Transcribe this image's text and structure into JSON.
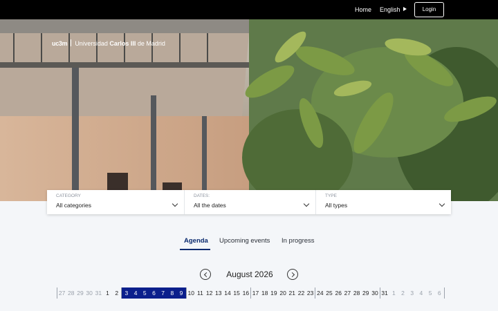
{
  "nav": {
    "home": "Home",
    "language": "English",
    "login": "Login"
  },
  "logo": {
    "mark": "uc3m",
    "prefix": "Universidad ",
    "bold": "Carlos III",
    "suffix": " de Madrid"
  },
  "filters": [
    {
      "label": "CATEGORY",
      "value": "All categories"
    },
    {
      "label": "DATES:",
      "value": "All the dates"
    },
    {
      "label": "TYPE",
      "value": "All types"
    }
  ],
  "tabs": [
    {
      "label": "Agenda",
      "active": true
    },
    {
      "label": "Upcoming events",
      "active": false
    },
    {
      "label": "In progress",
      "active": false
    }
  ],
  "calendar": {
    "month": "August 2026",
    "days": [
      {
        "d": "27",
        "s": "muted"
      },
      {
        "d": "28",
        "s": "muted"
      },
      {
        "d": "29",
        "s": "muted"
      },
      {
        "d": "30",
        "s": "muted"
      },
      {
        "d": "31",
        "s": "muted"
      },
      {
        "d": "1",
        "s": ""
      },
      {
        "d": "2",
        "s": ""
      },
      {
        "sep": true
      },
      {
        "d": "3",
        "s": "sel"
      },
      {
        "d": "4",
        "s": "sel"
      },
      {
        "d": "5",
        "s": "sel"
      },
      {
        "d": "6",
        "s": "sel"
      },
      {
        "d": "7",
        "s": "sel"
      },
      {
        "d": "8",
        "s": "sel"
      },
      {
        "d": "9",
        "s": "sel"
      },
      {
        "sep": true
      },
      {
        "d": "10",
        "s": ""
      },
      {
        "d": "11",
        "s": ""
      },
      {
        "d": "12",
        "s": ""
      },
      {
        "d": "13",
        "s": ""
      },
      {
        "d": "14",
        "s": ""
      },
      {
        "d": "15",
        "s": ""
      },
      {
        "d": "16",
        "s": ""
      },
      {
        "sep": true
      },
      {
        "d": "17",
        "s": ""
      },
      {
        "d": "18",
        "s": ""
      },
      {
        "d": "19",
        "s": ""
      },
      {
        "d": "20",
        "s": ""
      },
      {
        "d": "21",
        "s": ""
      },
      {
        "d": "22",
        "s": ""
      },
      {
        "d": "23",
        "s": ""
      },
      {
        "sep": true
      },
      {
        "d": "24",
        "s": ""
      },
      {
        "d": "25",
        "s": ""
      },
      {
        "d": "26",
        "s": ""
      },
      {
        "d": "27",
        "s": ""
      },
      {
        "d": "28",
        "s": ""
      },
      {
        "d": "29",
        "s": ""
      },
      {
        "d": "30",
        "s": ""
      },
      {
        "sep": true
      },
      {
        "d": "31",
        "s": ""
      },
      {
        "d": "1",
        "s": "muted"
      },
      {
        "d": "2",
        "s": "muted"
      },
      {
        "d": "3",
        "s": "muted"
      },
      {
        "d": "4",
        "s": "muted"
      },
      {
        "d": "5",
        "s": "muted"
      },
      {
        "d": "6",
        "s": "muted"
      }
    ]
  },
  "colors": {
    "selected": "#0b1f8c",
    "active_tab": "#0a2a6e",
    "topbar": "#000000"
  }
}
